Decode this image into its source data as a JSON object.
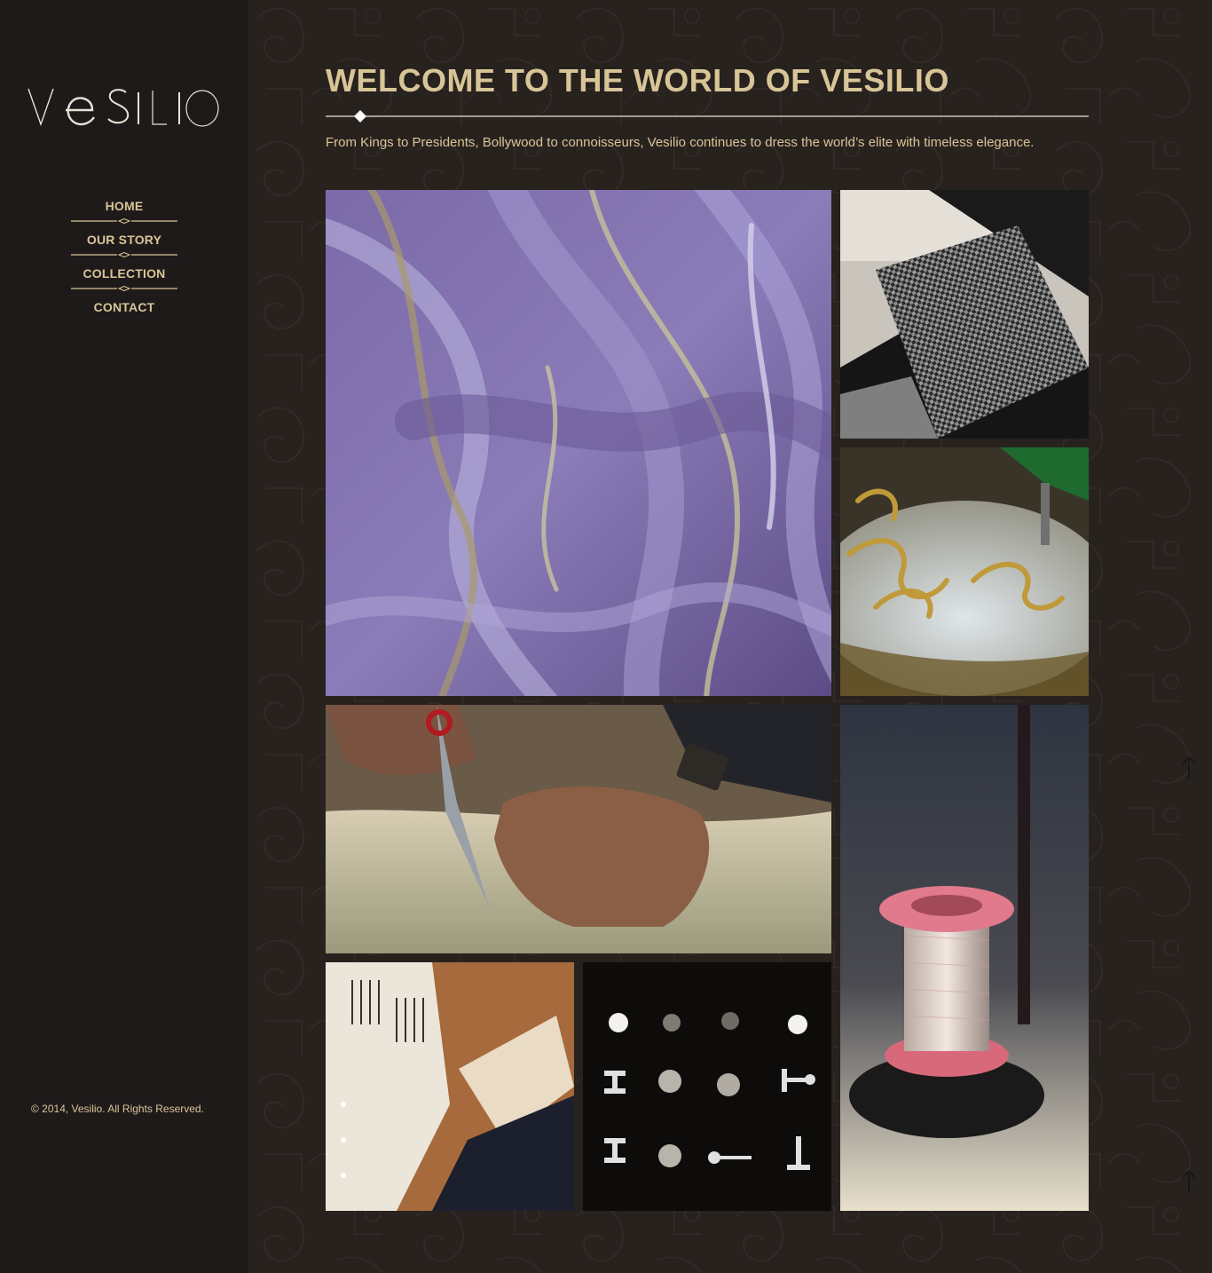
{
  "brand": {
    "logo_text": "VeSILIO"
  },
  "nav": {
    "items": [
      {
        "label": "HOME"
      },
      {
        "label": "OUR STORY"
      },
      {
        "label": "COLLECTION"
      },
      {
        "label": "CONTACT"
      }
    ]
  },
  "footer": {
    "copyright": "© 2014, Vesilio. All Rights Reserved."
  },
  "main": {
    "headline": "WELCOME TO THE WORLD OF VESILIO",
    "intro": "From Kings to Presidents, Bollywood to connoisseurs, Vesilio continues to dress the world’s elite with timeless elegance."
  },
  "gallery": [
    {
      "subject": "purple wool roving"
    },
    {
      "subject": "houndstooth fabric swatch"
    },
    {
      "subject": "gold embroidery machine"
    },
    {
      "subject": "tailor cutting fabric with scissors"
    },
    {
      "subject": "pink spool of silver thread"
    },
    {
      "subject": "pattern paper and fabric samples"
    },
    {
      "subject": "buttons and cufflinks"
    }
  ],
  "colors": {
    "accent": "#d8c597",
    "sidebar_bg": "#1f1a1a",
    "main_bg": "#28221f"
  },
  "icons": {
    "back_to_top": "arrow-up-icon"
  }
}
